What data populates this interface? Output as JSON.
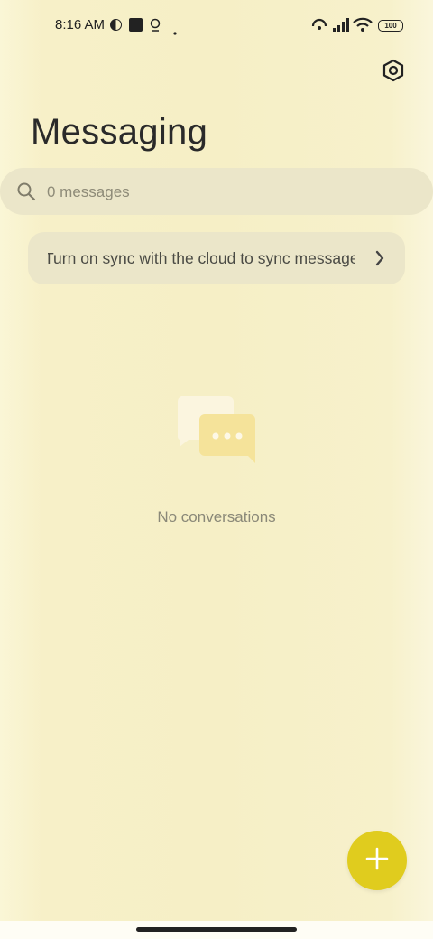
{
  "status_bar": {
    "time": "8:16 AM",
    "battery": "100"
  },
  "header": {
    "title": "Messaging",
    "settings_icon": "settings-hex-icon"
  },
  "search": {
    "placeholder": "0 messages",
    "icon": "search-icon"
  },
  "sync_banner": {
    "text": "Turn on sync with the cloud to sync messages",
    "chevron_icon": "chevron-right-icon"
  },
  "empty_state": {
    "illustration_icon": "chat-bubbles-icon",
    "text": "No conversations"
  },
  "fab": {
    "icon": "plus-icon",
    "color": "#e0cc1e"
  },
  "colors": {
    "background": "#f6efc6",
    "surface": "#ebe6c9",
    "accent": "#e0cc1e"
  }
}
